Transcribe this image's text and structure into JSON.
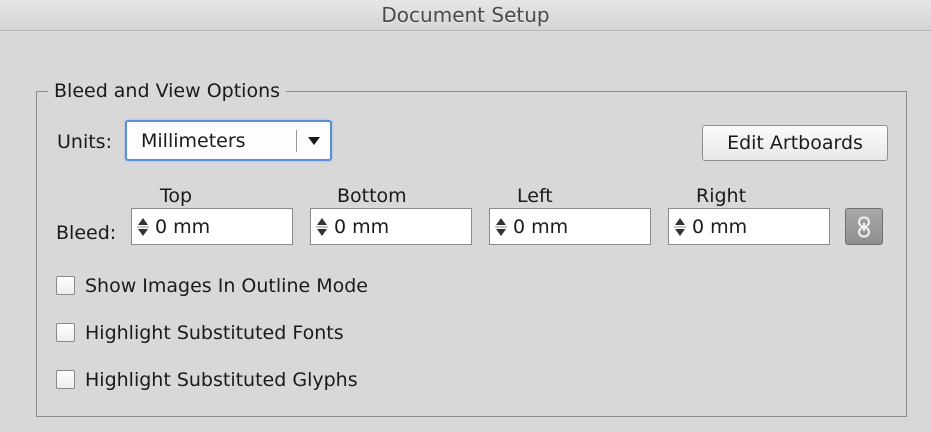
{
  "window": {
    "title": "Document Setup"
  },
  "panel": {
    "legend": "Bleed and View Options"
  },
  "units": {
    "label": "Units:",
    "selected": "Millimeters"
  },
  "edit_artboards_button": "Edit Artboards",
  "bleed": {
    "label": "Bleed:",
    "fields": [
      {
        "label": "Top",
        "value": "0 mm"
      },
      {
        "label": "Bottom",
        "value": "0 mm"
      },
      {
        "label": "Left",
        "value": "0 mm"
      },
      {
        "label": "Right",
        "value": "0 mm"
      }
    ]
  },
  "options": [
    {
      "label": "Show Images In Outline Mode",
      "checked": false
    },
    {
      "label": "Highlight Substituted Fonts",
      "checked": false
    },
    {
      "label": "Highlight Substituted Glyphs",
      "checked": false
    }
  ],
  "icons": {
    "select_arrow": "dropdown-arrow-icon",
    "spinner": "up-down-arrows-icon",
    "link": "chain-link-icon"
  }
}
